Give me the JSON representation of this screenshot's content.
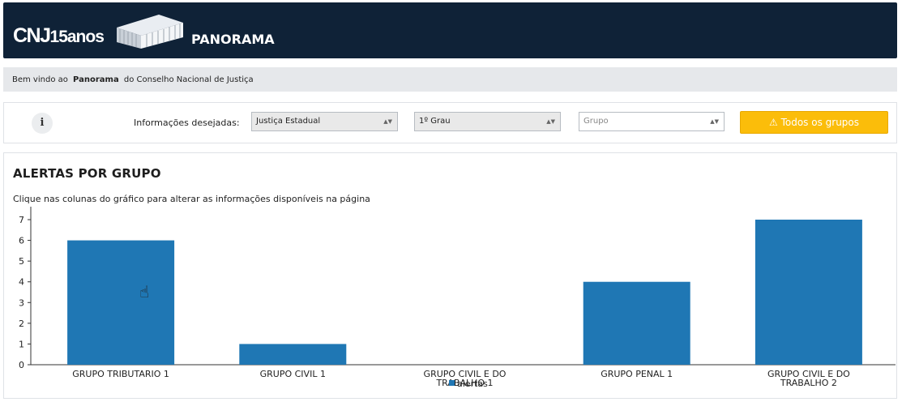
{
  "header": {
    "logo_text": "CNJ",
    "logo_anniversary": "15anos",
    "app_title": "PANORAMA"
  },
  "welcome": {
    "prefix": "Bem vindo ao",
    "app_name": "Panorama",
    "suffix": "do Conselho Nacional de Justiça"
  },
  "filters": {
    "info_label": "i",
    "label": "Informações desejadas:",
    "justica": {
      "value": "Justiça Estadual"
    },
    "grau": {
      "value": "1º Grau"
    },
    "grupo": {
      "placeholder": "Grupo"
    },
    "all_groups_button": "Todos os grupos"
  },
  "panel": {
    "title": "ALERTAS POR GRUPO",
    "subtitle": "Clique nas colunas do gráfico para alterar as informações disponíveis na página"
  },
  "chart_data": {
    "type": "bar",
    "categories": [
      "GRUPO TRIBUTARIO 1",
      "GRUPO CIVIL 1",
      "GRUPO CIVIL E DO TRABALHO 1",
      "GRUPO PENAL 1",
      "GRUPO CIVIL E DO TRABALHO 2"
    ],
    "series": [
      {
        "name": "alertas",
        "values": [
          6,
          1,
          0,
          4,
          7
        ]
      }
    ],
    "ylim": [
      0,
      7
    ],
    "yticks": [
      0,
      1,
      2,
      3,
      4,
      5,
      6,
      7
    ],
    "legend": "bottom-center",
    "color": "#1f77b4"
  }
}
